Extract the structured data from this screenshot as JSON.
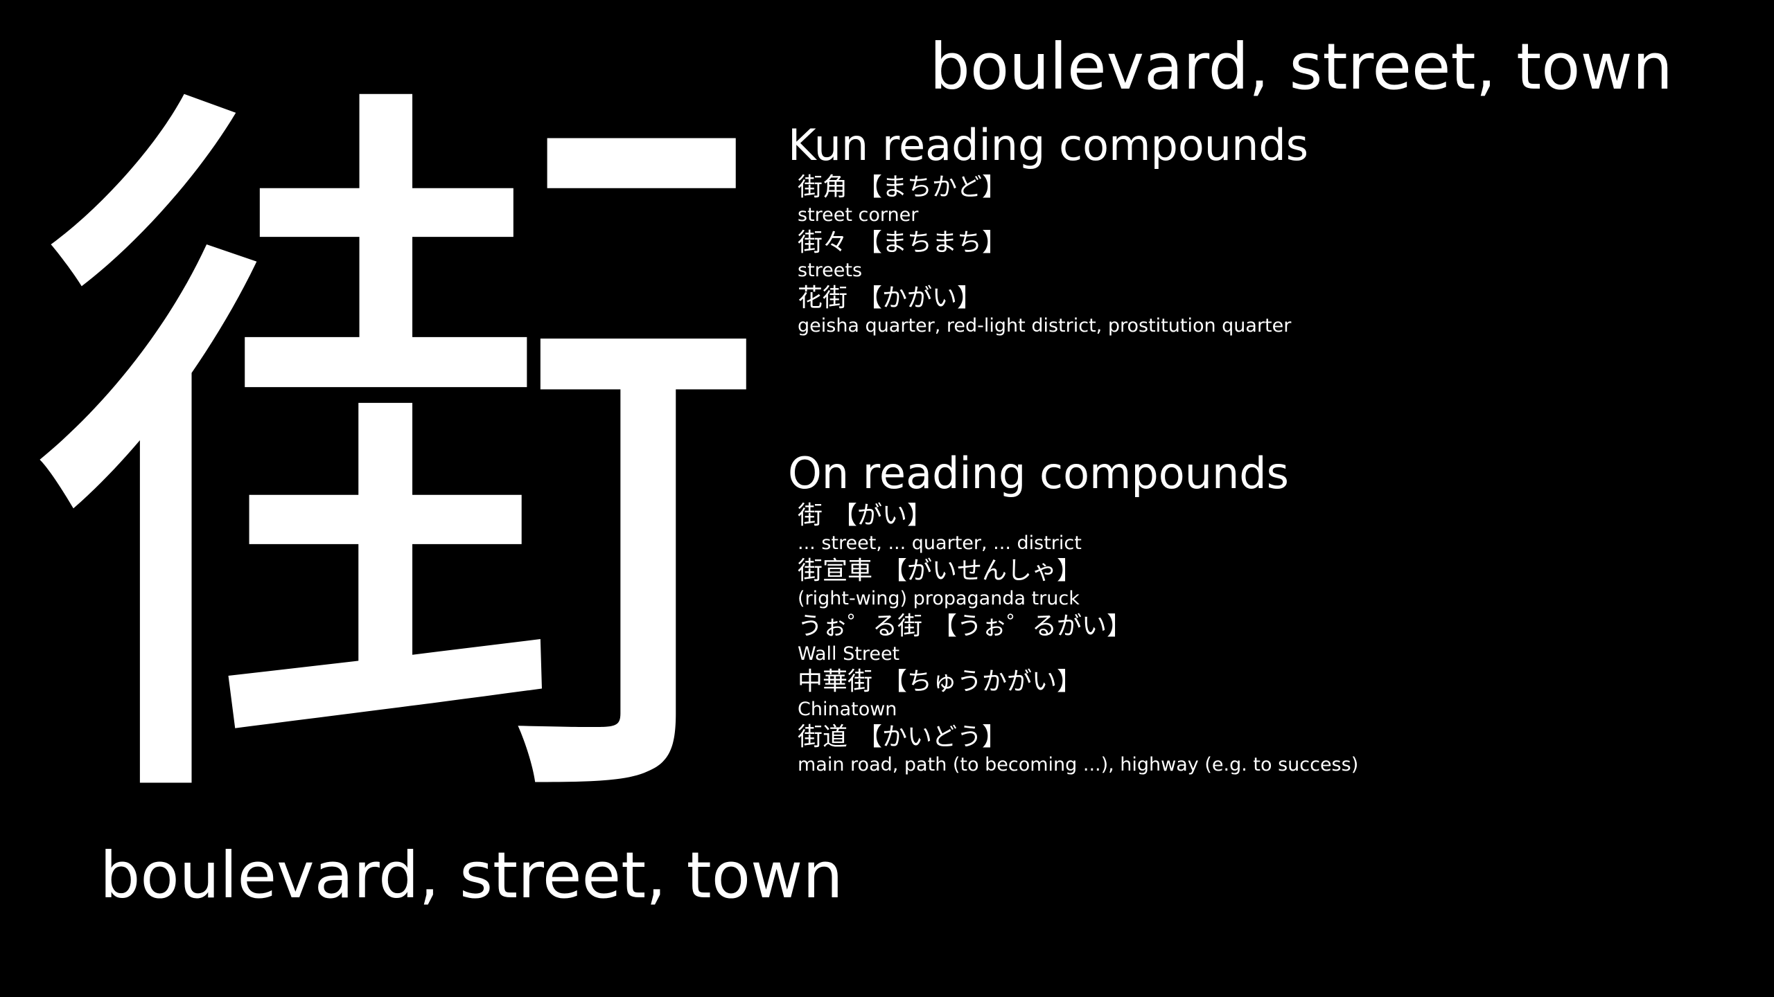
{
  "kanji": "街",
  "meaning": "boulevard, street, town",
  "kun": {
    "title": "Kun reading compounds",
    "items": [
      {
        "word": "街角",
        "reading": "【まちかど】",
        "gloss": "street corner"
      },
      {
        "word": "街々",
        "reading": "【まちまち】",
        "gloss": "streets"
      },
      {
        "word": "花街",
        "reading": "【かがい】",
        "gloss": "geisha quarter, red-light district, prostitution quarter"
      }
    ]
  },
  "on": {
    "title": "On reading compounds",
    "items": [
      {
        "word": "街",
        "reading": "【がい】",
        "gloss": "... street, ... quarter, ... district"
      },
      {
        "word": "街宣車",
        "reading": "【がいせんしゃ】",
        "gloss": "(right-wing) propaganda truck"
      },
      {
        "word": "うぉ゜る街",
        "reading": "【うぉ゜るがい】",
        "gloss": "Wall Street"
      },
      {
        "word": "中華街",
        "reading": "【ちゅうかがい】",
        "gloss": "Chinatown"
      },
      {
        "word": "街道",
        "reading": "【かいどう】",
        "gloss": "main road, path (to becoming ...), highway (e.g. to success)"
      }
    ]
  }
}
